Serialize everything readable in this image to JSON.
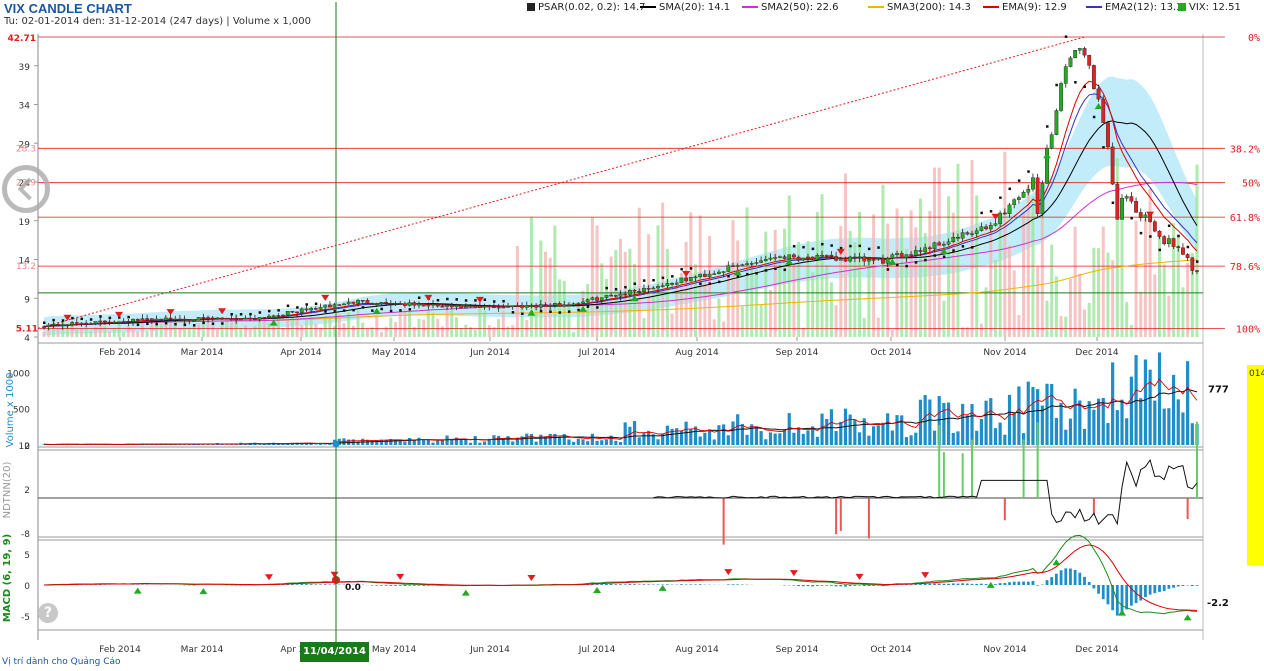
{
  "title": "VIX CANDLE CHART",
  "subtitle": "Tu: 02-01-2014 den: 31-12-2014 (247 days) | Volume x 1,000",
  "legend": [
    {
      "label": "PSAR(0.02, 0.2): 14.7",
      "color": "#222222",
      "kind": "square"
    },
    {
      "label": "SMA(20): 14.1",
      "color": "#000000",
      "kind": "line"
    },
    {
      "label": "SMA2(50): 22.6",
      "color": "#cc33cc",
      "kind": "line"
    },
    {
      "label": "SMA3(200): 14.3",
      "color": "#f0b400",
      "kind": "line"
    },
    {
      "label": "EMA(9): 12.9",
      "color": "#e00000",
      "kind": "line"
    },
    {
      "label": "EMA2(12): 13.3",
      "color": "#3333cc",
      "kind": "line"
    },
    {
      "label": "VIX: 12.51",
      "color": "#22aa22",
      "kind": "square"
    }
  ],
  "ad_text": "Vị trí dành cho Quảng Cáo",
  "crosshair_date": "11/04/2014",
  "side_label": "014",
  "help_icon": "?",
  "colors": {
    "up": "#22aa22",
    "down": "#dd2222",
    "volume": "#1f8ec8",
    "band": "#a8e4f7",
    "fib": "#e31b1b"
  },
  "chart_data": [
    {
      "type": "candlestick",
      "title": "VIX CANDLE CHART",
      "x_ticks": [
        "Feb 2014",
        "Mar 2014",
        "Apr 2014",
        "May 2014",
        "Jun 2014",
        "Jul 2014",
        "Aug 2014",
        "Sep 2014",
        "Oct 2014",
        "Nov 2014",
        "Dec 2014"
      ],
      "y_ticks": [
        "4",
        "9",
        "14",
        "19",
        "24",
        "29",
        "34",
        "39"
      ],
      "ylim": [
        4,
        42.71
      ],
      "max_label": "42.71",
      "min_label": "5.11",
      "fib_levels": [
        {
          "label": "0%",
          "value": 42.71
        },
        {
          "label": "38.2%",
          "value": 28.35
        },
        {
          "label": "50%",
          "value": 23.91
        },
        {
          "label": "61.8%",
          "value": 19.47
        },
        {
          "label": "78.6%",
          "value": 13.15
        },
        {
          "label": "100%",
          "value": 5.11
        }
      ],
      "fib_left_labels": [
        "28.3",
        "23.9",
        "13.2"
      ],
      "close_by_month": [
        {
          "month": "Jan 2014",
          "close": 5.5
        },
        {
          "month": "Feb 2014",
          "close": 6.3
        },
        {
          "month": "Mar 2014",
          "close": 6.4
        },
        {
          "month": "Apr 2014",
          "close": 8.6
        },
        {
          "month": "May 2014",
          "close": 7.8
        },
        {
          "month": "Jun 2014",
          "close": 8.2
        },
        {
          "month": "Jul 2014",
          "close": 11.0
        },
        {
          "month": "Aug 2014",
          "close": 14.5
        },
        {
          "month": "Sep 2014",
          "close": 13.8
        },
        {
          "month": "Oct 2014",
          "close": 18.0
        },
        {
          "month": "Nov 2014",
          "close": 32.0
        },
        {
          "month": "Dec 2014",
          "close": 12.51
        }
      ]
    },
    {
      "type": "bar",
      "ylabel": "Volume x 1000",
      "y_ticks": [
        "0",
        "500",
        "1000"
      ],
      "last_value_label": "777",
      "monthly_avg_volume": [
        10,
        15,
        20,
        60,
        80,
        100,
        200,
        260,
        300,
        420,
        520,
        760
      ]
    },
    {
      "type": "line",
      "ylabel": "NDTNN(20)",
      "y_ticks": [
        "12",
        "2",
        "-8"
      ]
    },
    {
      "type": "line",
      "ylabel": "MACD (6, 19, 9)",
      "y_ticks": [
        "5",
        "0",
        "-5"
      ],
      "last_value_label": "-2.2",
      "cursor_value_label": "0.0"
    }
  ]
}
